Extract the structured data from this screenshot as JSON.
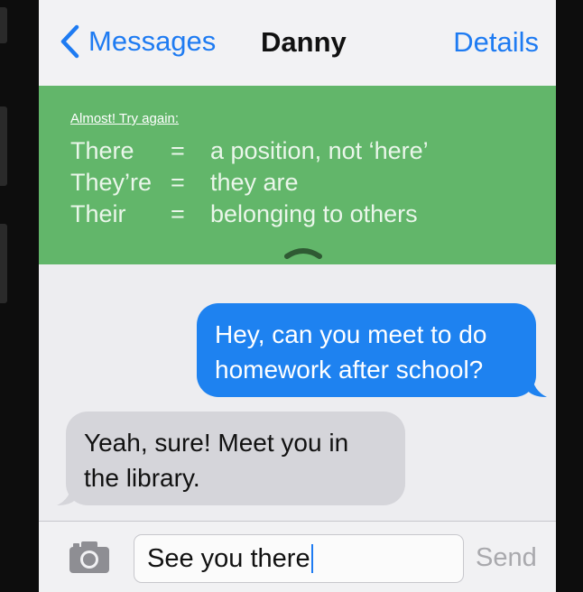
{
  "nav": {
    "back_label": "Messages",
    "title": "Danny",
    "details_label": "Details"
  },
  "hint": {
    "heading": "Almost! Try again:",
    "rows": [
      {
        "word": "There",
        "eq": "=",
        "definition": "a position, not ‘here’"
      },
      {
        "word": "They’re",
        "eq": "=",
        "definition": "they are"
      },
      {
        "word": "Their",
        "eq": "=",
        "definition": "belonging to others"
      }
    ]
  },
  "messages": [
    {
      "direction": "outgoing",
      "text": "Hey, can you meet to do homework after school?"
    },
    {
      "direction": "incoming",
      "text": "Yeah, sure! Meet you in the library."
    }
  ],
  "composer": {
    "value": "See you there",
    "send_label": "Send",
    "camera_icon": "camera-icon"
  },
  "colors": {
    "accent": "#1e7bf2",
    "hint_background": "#62b66a",
    "outgoing_bubble": "#1e82f0",
    "incoming_bubble": "#d5d5da"
  }
}
